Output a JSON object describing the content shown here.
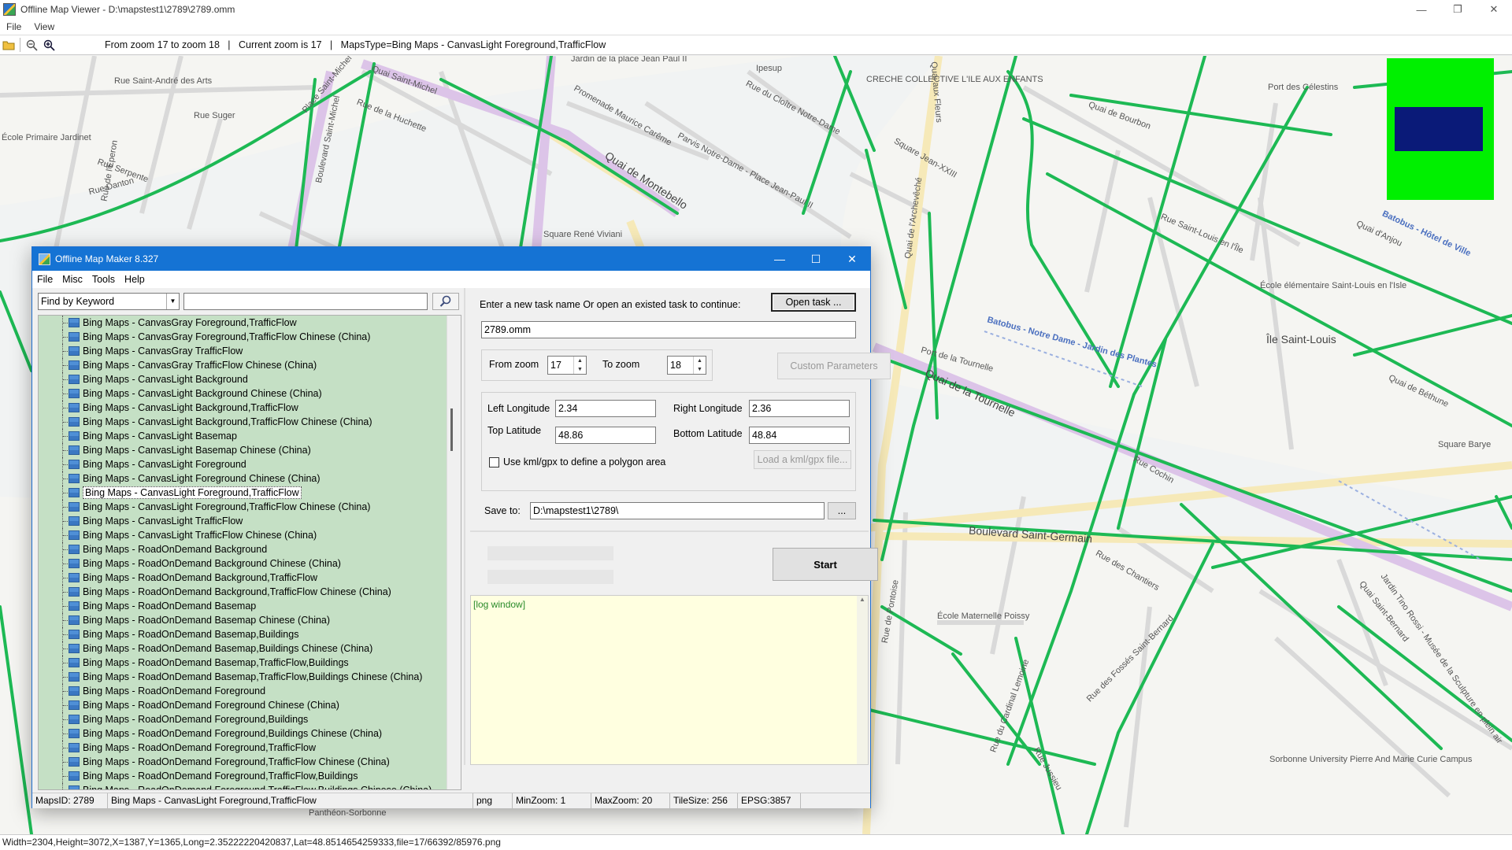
{
  "window": {
    "title": "Offline Map Viewer - D:\\mapstest1\\2789\\2789.omm",
    "controls": [
      "—",
      "❐",
      "✕"
    ]
  },
  "menubar": [
    "File",
    "View"
  ],
  "toolbar": {
    "info": "From zoom 17 to zoom 18   |   Current zoom is 17   |   MapsType=Bing Maps - CanvasLight Foreground,TrafficFlow"
  },
  "map": {
    "labels": [
      "Rue Saint-André des Arts",
      "Rue Suger",
      "École Primaire Jardinet",
      "Rue de l'Éperon",
      "Rue Serpente",
      "Rue Danton",
      "Boulevard Saint-Michel",
      "Place Saint-Michel",
      "Quai Saint-Michel",
      "Rue de la Huchette",
      "Jardin de la place Jean Paul II",
      "Promenade Maurice Carême",
      "Quai de Montebello",
      "Square René Viviani",
      "Ipesup",
      "Rue du Cloître Notre-Dame",
      "Parvis Notre-Dame - Place Jean-Paul II",
      "CRECHE COLLECTIVE L'ILE AUX ENFANTS",
      "Quai aux Fleurs",
      "Square Jean-XXIII",
      "Quai de l'Archevêché",
      "Port des Célestins",
      "Quai de Bourbon",
      "Rue Saint-Louis en l'Île",
      "Quai d'Anjou",
      "École élémentaire Saint-Louis en l'Isle",
      "Île Saint-Louis",
      "Batobus - Notre Dame - Jardin des Plantes",
      "Port de la Tournelle",
      "Quai de la Tournelle",
      "Quai de Béthune",
      "Boulevard Saint-Germain",
      "Square Barye",
      "Rue des Chantiers",
      "École Maternelle Poissy",
      "Rue des Fossés Saint-Bernard",
      "Jardin Tino Rossi - Musée de la Sculpture en plein air",
      "Sorbonne University Pierre And Marie Curie Campus",
      "Panthéon-Sorbonne",
      "Quai Saint-Bernard",
      "Rue Cochin",
      "Rue de Pontoise",
      "Batobus - Hôtel de Ville",
      "Rue Jussieu",
      "Rue du Cardinal Lemoine"
    ]
  },
  "statusbar": "Width=2304,Height=3072,X=1387,Y=1365,Long=2.35222220420837,Lat=48.8514654259333,file=17/66392/85976.png",
  "dialog": {
    "title": "Offline Map Maker 8.327",
    "controls": [
      "—",
      "☐",
      "✕"
    ],
    "menu": [
      "File",
      "Misc",
      "Tools",
      "Help"
    ],
    "search": {
      "mode": "Find by Keyword",
      "value": ""
    },
    "tree_items": [
      "Bing Maps - CanvasGray Foreground,TrafficFlow",
      "Bing Maps - CanvasGray Foreground,TrafficFlow Chinese (China)",
      "Bing Maps - CanvasGray TrafficFlow",
      "Bing Maps - CanvasGray TrafficFlow Chinese (China)",
      "Bing Maps - CanvasLight Background",
      "Bing Maps - CanvasLight Background Chinese (China)",
      "Bing Maps - CanvasLight Background,TrafficFlow",
      "Bing Maps - CanvasLight Background,TrafficFlow Chinese (China)",
      "Bing Maps - CanvasLight Basemap",
      "Bing Maps - CanvasLight Basemap Chinese (China)",
      "Bing Maps - CanvasLight Foreground",
      "Bing Maps - CanvasLight Foreground Chinese (China)",
      "Bing Maps - CanvasLight Foreground,TrafficFlow",
      "Bing Maps - CanvasLight Foreground,TrafficFlow Chinese (China)",
      "Bing Maps - CanvasLight TrafficFlow",
      "Bing Maps - CanvasLight TrafficFlow Chinese (China)",
      "Bing Maps - RoadOnDemand Background",
      "Bing Maps - RoadOnDemand Background Chinese (China)",
      "Bing Maps - RoadOnDemand Background,TrafficFlow",
      "Bing Maps - RoadOnDemand Background,TrafficFlow Chinese (China)",
      "Bing Maps - RoadOnDemand Basemap",
      "Bing Maps - RoadOnDemand Basemap Chinese (China)",
      "Bing Maps - RoadOnDemand Basemap,Buildings",
      "Bing Maps - RoadOnDemand Basemap,Buildings Chinese (China)",
      "Bing Maps - RoadOnDemand Basemap,TrafficFlow,Buildings",
      "Bing Maps - RoadOnDemand Basemap,TrafficFlow,Buildings Chinese (China)",
      "Bing Maps - RoadOnDemand Foreground",
      "Bing Maps - RoadOnDemand Foreground Chinese (China)",
      "Bing Maps - RoadOnDemand Foreground,Buildings",
      "Bing Maps - RoadOnDemand Foreground,Buildings Chinese (China)",
      "Bing Maps - RoadOnDemand Foreground,TrafficFlow",
      "Bing Maps - RoadOnDemand Foreground,TrafficFlow Chinese (China)",
      "Bing Maps - RoadOnDemand Foreground,TrafficFlow,Buildings",
      "Bing Maps - RoadOnDemand Foreground,TrafficFlow,Buildings Chinese (China)"
    ],
    "selected_tree_item": "Bing Maps - CanvasLight Foreground,TrafficFlow",
    "task_prompt": "Enter a new task name Or open an existed task to continue:",
    "open_task_label": "Open task ...",
    "task_name": "2789.omm",
    "from_zoom_label": "From zoom",
    "from_zoom": "17",
    "to_zoom_label": "To zoom",
    "to_zoom": "18",
    "custom_params_label": "Custom Parameters",
    "left_lon_label": "Left Longitude",
    "left_lon": "2.34",
    "right_lon_label": "Right Longitude",
    "right_lon": "2.36",
    "top_lat_label": "Top Latitude",
    "top_lat": "48.86",
    "bottom_lat_label": "Bottom Latitude",
    "bottom_lat": "48.84",
    "kml_checkbox_label": "Use kml/gpx to define a polygon area",
    "kml_checked": false,
    "load_kml_label": "Load a kml/gpx file...",
    "save_to_label": "Save to:",
    "save_to": "D:\\mapstest1\\2789\\",
    "browse_label": "...",
    "start_label": "Start",
    "log_text": "[log window]",
    "status": {
      "maps_id": "MapsID: 2789",
      "maps_name": "Bing Maps - CanvasLight Foreground,TrafficFlow",
      "format": "png",
      "min_zoom": "MinZoom: 1",
      "max_zoom": "MaxZoom: 20",
      "tile_size": "TileSize: 256",
      "epsg": "EPSG:3857"
    }
  },
  "colors": {
    "traffic_green": "#1db954",
    "river": "#f3f3ef",
    "tree_bg": "#c5e0c5",
    "log_bg": "#ffffe0",
    "dialog_title": "#1573d4",
    "minimap_bg": "#00f000",
    "minimap_viewport": "#0a1a78"
  }
}
